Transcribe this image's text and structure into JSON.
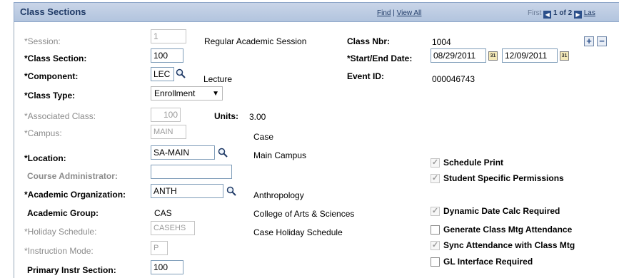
{
  "header": {
    "title": "Class Sections",
    "find": "Find",
    "view_all": "View All",
    "first": "First",
    "page_of": "1 of 2",
    "last": "Las"
  },
  "left": {
    "session_label": "*Session:",
    "session_value": "1",
    "session_desc": "Regular Academic Session",
    "class_section_label": "*Class Section:",
    "class_section_value": "100",
    "component_label": "*Component:",
    "component_value": "LEC",
    "component_desc": "Lecture",
    "class_type_label": "*Class Type:",
    "class_type_value": "Enrollment",
    "assoc_class_label": "*Associated Class:",
    "assoc_class_value": "100",
    "units_label": "Units:",
    "units_value": "3.00",
    "campus_label": "*Campus:",
    "campus_value": "MAIN",
    "campus_desc": "Case",
    "location_label": "*Location:",
    "location_value": "SA-MAIN",
    "location_desc": "Main Campus",
    "course_admin_label": "Course Administrator:",
    "course_admin_value": "",
    "acad_org_label": "*Academic Organization:",
    "acad_org_value": "ANTH",
    "acad_org_desc": "Anthropology",
    "acad_group_label": "Academic Group:",
    "acad_group_value": "CAS",
    "acad_group_desc": "College of Arts & Sciences",
    "holiday_label": "*Holiday Schedule:",
    "holiday_value": "CASEHS",
    "holiday_desc": "Case Holiday Schedule",
    "instr_mode_label": "*Instruction Mode:",
    "instr_mode_value": "P",
    "primary_instr_label": "Primary Instr Section:",
    "primary_instr_value": "100"
  },
  "right": {
    "class_nbr_label": "Class Nbr:",
    "class_nbr_value": "1004",
    "start_end_label": "*Start/End Date:",
    "start_date": "08/29/2011",
    "end_date": "12/09/2011",
    "event_id_label": "Event ID:",
    "event_id_value": "000046743",
    "calendar_glyph": "31"
  },
  "checkboxes": [
    {
      "label": "Schedule Print",
      "checked": true,
      "enabled": false
    },
    {
      "label": "Student Specific Permissions",
      "checked": true,
      "enabled": false
    },
    {
      "label": "Dynamic Date Calc Required",
      "checked": true,
      "enabled": false
    },
    {
      "label": "Generate Class Mtg Attendance",
      "checked": false,
      "enabled": true
    },
    {
      "label": "Sync Attendance with Class Mtg",
      "checked": true,
      "enabled": false
    },
    {
      "label": "GL Interface Required",
      "checked": false,
      "enabled": true
    }
  ],
  "icons": {
    "add": "+",
    "remove": "−",
    "dropdown": "▼",
    "check": "✓"
  },
  "colors": {
    "header_text": "#1f3a66",
    "header_bg": "#c9d5e8",
    "disabled_text": "#8b8b8b"
  }
}
